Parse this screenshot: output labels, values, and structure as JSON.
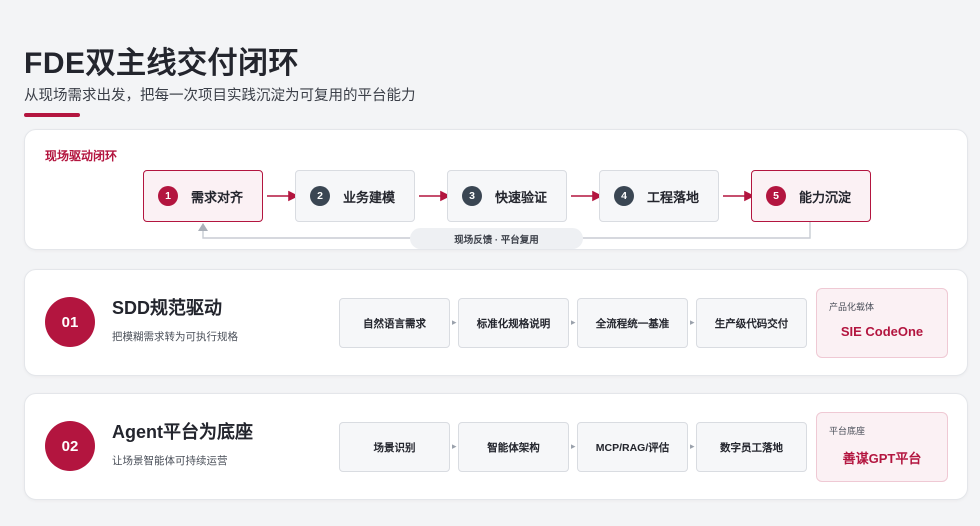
{
  "page": {
    "title": "FDE双主线交付闭环",
    "subtitle": "从现场需求出发，把每一次项目实践沉淀为可复用的平台能力"
  },
  "loop": {
    "title": "现场驱动闭环",
    "steps": [
      {
        "num": "1",
        "label": "需求对齐",
        "highlight": true
      },
      {
        "num": "2",
        "label": "业务建模",
        "highlight": false
      },
      {
        "num": "3",
        "label": "快速验证",
        "highlight": false
      },
      {
        "num": "4",
        "label": "工程落地",
        "highlight": false
      },
      {
        "num": "5",
        "label": "能力沉淀",
        "highlight": true
      }
    ],
    "feedback_label": "现场反馈 · 平台复用"
  },
  "rows": [
    {
      "badge": "01",
      "title": "SDD规范驱动",
      "desc": "把模糊需求转为可执行规格",
      "chips": [
        "自然语言需求",
        "标准化规格说明",
        "全流程统一基准",
        "生产级代码交付"
      ],
      "product_label": "产品化载体",
      "product_name": "SIE CodeOne"
    },
    {
      "badge": "02",
      "title": "Agent平台为底座",
      "desc": "让场景智能体可持续运营",
      "chips": [
        "场景识别",
        "智能体架构",
        "MCP/RAG/评估",
        "数字员工落地"
      ],
      "product_label": "平台底座",
      "product_name": "善谋GPT平台"
    }
  ],
  "colors": {
    "accent": "#b3153f",
    "step_num_dark": "#3a4653",
    "background": "#f3f4f6"
  },
  "icons": {
    "chip_arrow": "chevron-right-icon",
    "flow_arrow": "arrow-right-icon"
  }
}
